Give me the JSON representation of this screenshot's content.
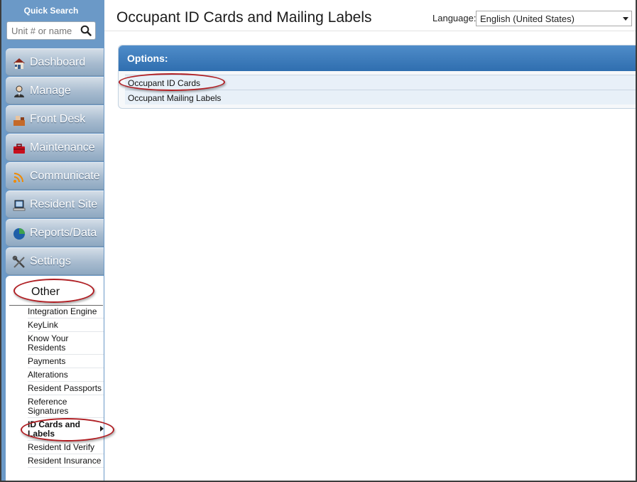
{
  "sidebar": {
    "quick_search_title": "Quick Search",
    "search_placeholder": "Unit # or name",
    "nav": [
      {
        "label": "Dashboard",
        "icon": "house-icon"
      },
      {
        "label": "Manage",
        "icon": "person-icon"
      },
      {
        "label": "Front Desk",
        "icon": "front-desk-icon"
      },
      {
        "label": "Maintenance",
        "icon": "toolbox-icon"
      },
      {
        "label": "Communicate",
        "icon": "wifi-icon"
      },
      {
        "label": "Resident Site",
        "icon": "laptop-icon"
      },
      {
        "label": "Reports/Data",
        "icon": "pie-chart-icon"
      },
      {
        "label": "Settings",
        "icon": "wrench-screwdriver-icon"
      }
    ],
    "other_label": "Other",
    "other_items": [
      "Integration Engine",
      "KeyLink",
      "Know Your Residents",
      "Payments",
      "Alterations",
      "Resident Passports",
      "Reference Signatures",
      "ID Cards and Labels",
      "Resident Id Verify",
      "Resident Insurance"
    ]
  },
  "header": {
    "title": "Occupant ID Cards and Mailing Labels",
    "language_label": "Language:",
    "language_value": "English (United States)"
  },
  "options": {
    "title": "Options:",
    "items": [
      "Occupant ID Cards",
      "Occupant Mailing Labels"
    ]
  },
  "colors": {
    "sidebar_bg": "#6b99c7",
    "panel_header": "#3e7dbd",
    "annotation": "#b01e23"
  }
}
